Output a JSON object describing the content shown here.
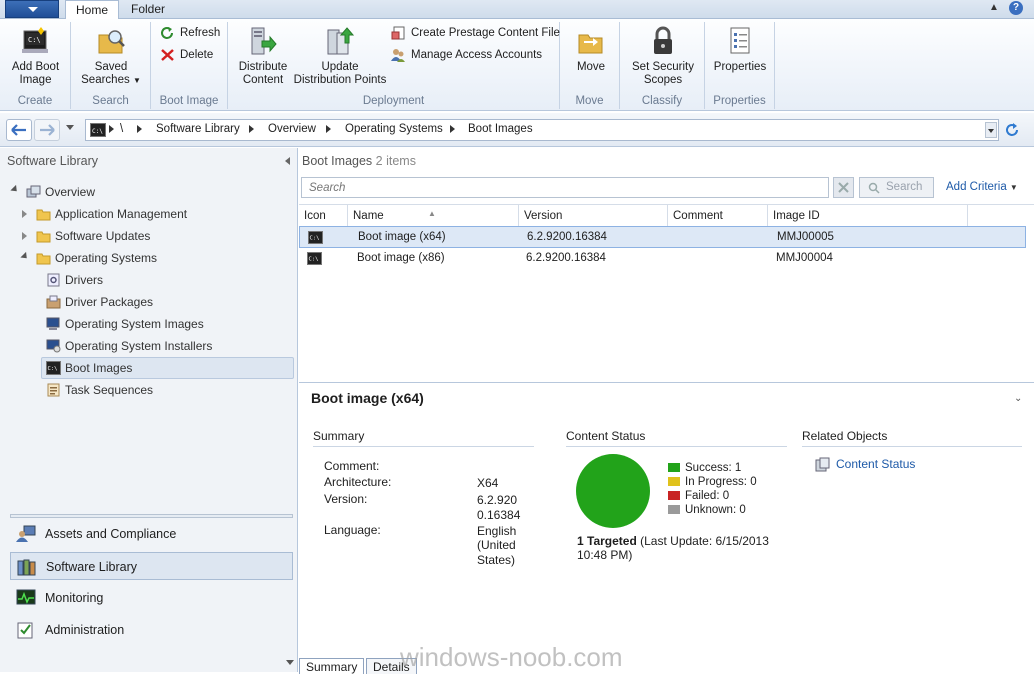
{
  "ribbon": {
    "tabs": [
      "Home",
      "Folder"
    ],
    "groups": {
      "create": {
        "label": "Create",
        "add_boot_image_l1": "Add Boot",
        "add_boot_image_l2": "Image"
      },
      "search": {
        "label": "Search",
        "saved_searches_l1": "Saved",
        "saved_searches_l2": "Searches"
      },
      "boot_image": {
        "label": "Boot Image",
        "refresh": "Refresh",
        "delete": "Delete"
      },
      "deployment": {
        "label": "Deployment",
        "distribute_l1": "Distribute",
        "distribute_l2": "Content",
        "update_l1": "Update",
        "update_l2": "Distribution Points",
        "prestage": "Create Prestage Content File",
        "access": "Manage Access Accounts"
      },
      "move": {
        "label": "Move",
        "move": "Move"
      },
      "classify": {
        "label": "Classify",
        "scopes_l1": "Set Security",
        "scopes_l2": "Scopes"
      },
      "properties": {
        "label": "Properties",
        "properties": "Properties"
      }
    }
  },
  "nav": {
    "breadcrumb": [
      "\\",
      "Software Library",
      "Overview",
      "Operating Systems",
      "Boot Images"
    ]
  },
  "left": {
    "title": "Software Library",
    "tree": {
      "overview": "Overview",
      "app_mgmt": "Application Management",
      "sw_updates": "Software Updates",
      "os": "Operating Systems",
      "drivers": "Drivers",
      "driver_packages": "Driver Packages",
      "os_images": "Operating System Images",
      "os_installers": "Operating System Installers",
      "boot_images": "Boot Images",
      "task_sequences": "Task Sequences"
    },
    "workspaces": [
      "Assets and Compliance",
      "Software Library",
      "Monitoring",
      "Administration"
    ]
  },
  "list": {
    "title": "Boot Images",
    "count": "2 items",
    "search_placeholder": "Search",
    "search_button": "Search",
    "add_criteria": "Add Criteria",
    "columns": [
      "Icon",
      "Name",
      "Version",
      "Comment",
      "Image ID"
    ],
    "rows": [
      {
        "name": "Boot image (x64)",
        "version": "6.2.9200.16384",
        "comment": "",
        "image_id": "MMJ00005"
      },
      {
        "name": "Boot image (x86)",
        "version": "6.2.9200.16384",
        "comment": "",
        "image_id": "MMJ00004"
      }
    ]
  },
  "detail": {
    "title": "Boot image (x64)",
    "summary": {
      "heading": "Summary",
      "comment_label": "Comment:",
      "architecture_label": "Architecture:",
      "architecture": "X64",
      "version_label": "Version:",
      "version_l1": "6.2.920",
      "version_l2": "0.16384",
      "language_label": "Language:",
      "language_l1": "English",
      "language_l2": "(United",
      "language_l3": "States)"
    },
    "content_status": {
      "heading": "Content Status",
      "legend": [
        {
          "label": "Success: 1",
          "color": "#22a31a"
        },
        {
          "label": "In Progress: 0",
          "color": "#e0c21c"
        },
        {
          "label": "Failed: 0",
          "color": "#c82424"
        },
        {
          "label": "Unknown: 0",
          "color": "#9a9a9a"
        }
      ],
      "targeted": "1 Targeted",
      "last_update_l1": "(Last Update: 6/15/2013",
      "last_update_l2": "10:48 PM)"
    },
    "related": {
      "heading": "Related Objects",
      "link": "Content Status"
    },
    "tabs": [
      "Summary",
      "Details"
    ]
  },
  "watermark": "windows-noob.com"
}
